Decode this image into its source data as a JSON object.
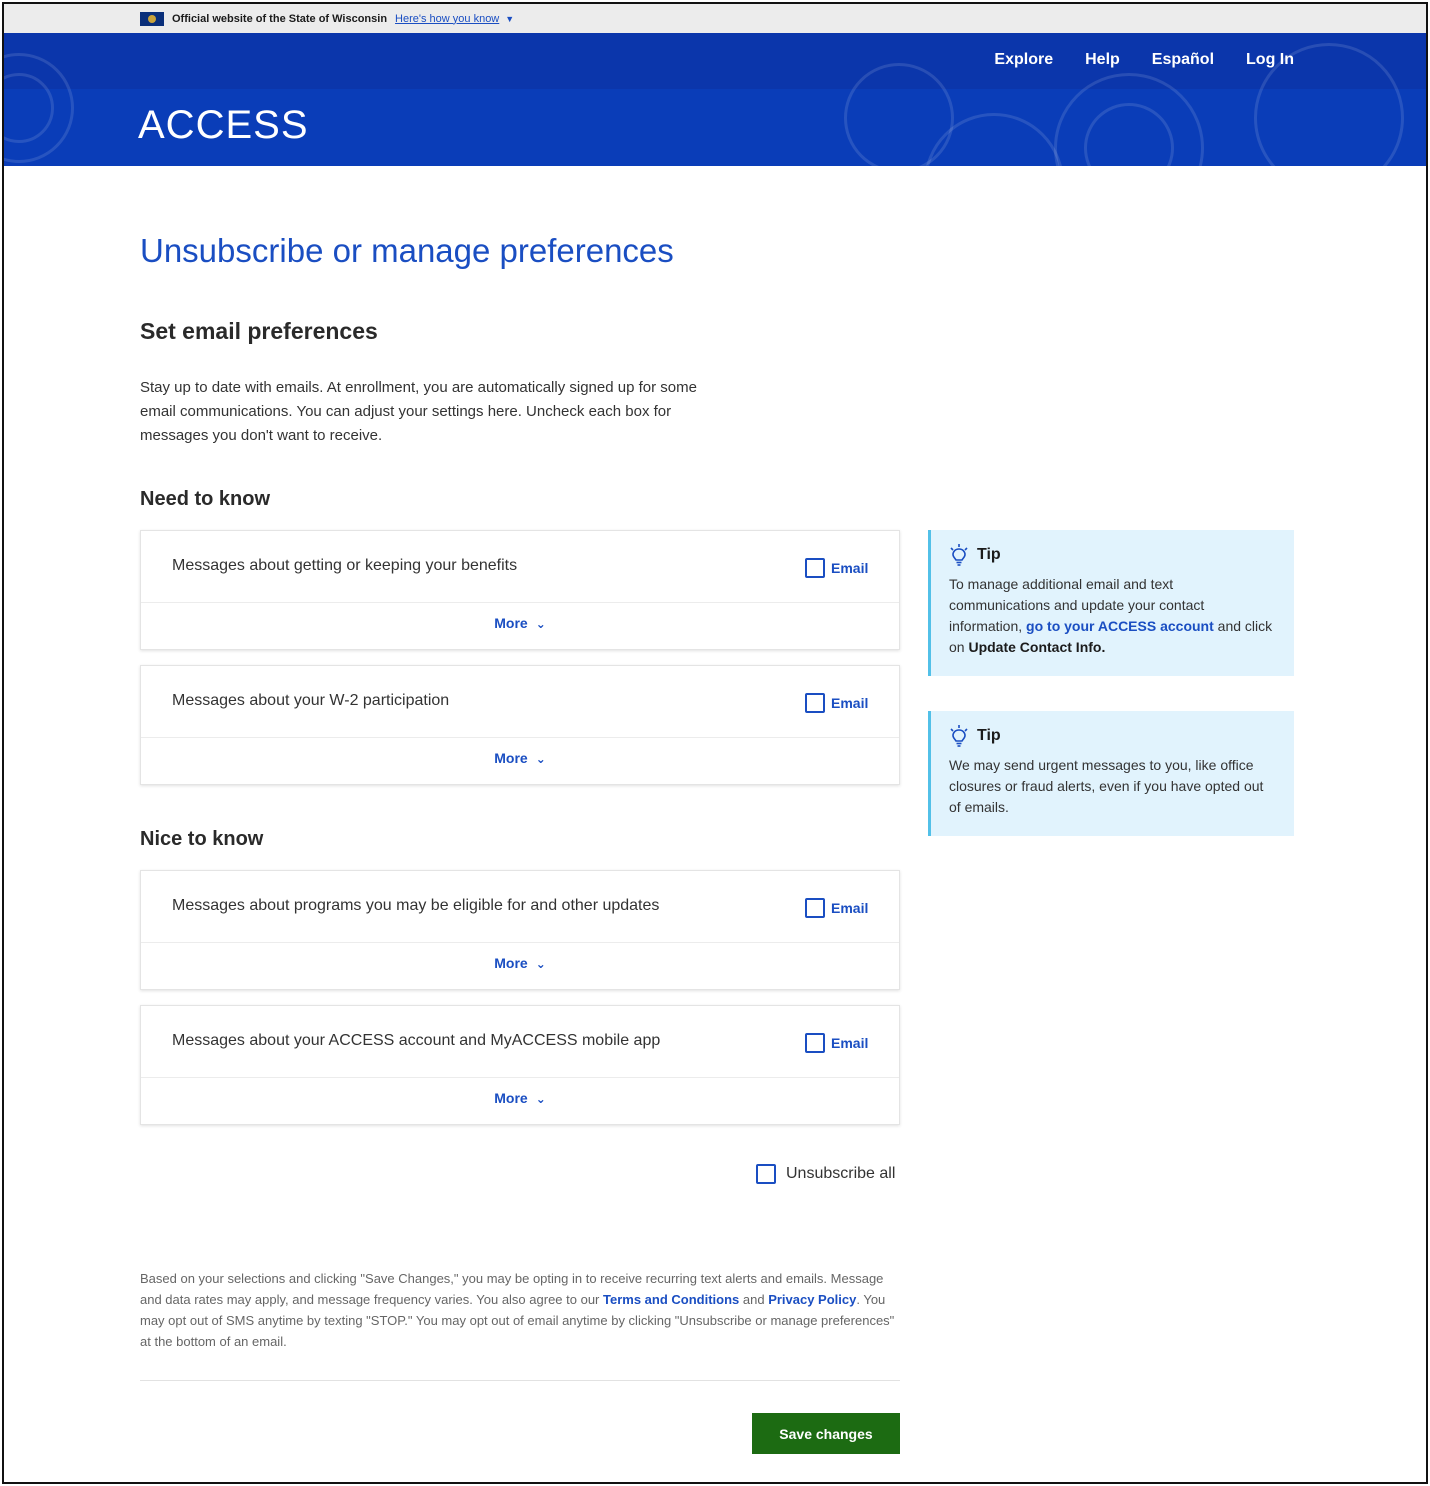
{
  "banner": {
    "official_text": "Official website of the State of Wisconsin",
    "how_know": "Here's how you know"
  },
  "nav": [
    "Explore",
    "Help",
    "Español",
    "Log In"
  ],
  "brand": "ACCESS",
  "page_title": "Unsubscribe or manage preferences",
  "section_title": "Set email preferences",
  "intro": "Stay up to date with emails. At enrollment, you are automatically signed up for some email communications. You can adjust your settings here. Uncheck each box for messages you don't want to receive.",
  "groups": [
    {
      "title": "Need to know",
      "items": [
        {
          "label": "Messages about getting or keeping your benefits",
          "check_label": "Email",
          "checked": false,
          "more": "More"
        },
        {
          "label": "Messages about your W-2 participation",
          "check_label": "Email",
          "checked": false,
          "more": "More"
        }
      ]
    },
    {
      "title": "Nice to know",
      "items": [
        {
          "label": "Messages about programs you may be eligible for and other updates",
          "check_label": "Email",
          "checked": false,
          "more": "More"
        },
        {
          "label": "Messages about your ACCESS account and MyACCESS mobile app",
          "check_label": "Email",
          "checked": false,
          "more": "More"
        }
      ]
    }
  ],
  "unsubscribe_all": {
    "label": "Unsubscribe all",
    "checked": false
  },
  "disclaimer": {
    "part1": "Based on your selections and clicking \"Save Changes,\" you may be opting in to receive recurring text alerts and emails. Message and data rates may apply, and message frequency varies. You also agree to our ",
    "terms": "Terms and Conditions",
    "part2": " and ",
    "privacy": "Privacy Policy",
    "part3": ". You may opt out of SMS anytime by texting \"STOP.\" You may opt out of email anytime by clicking \"Unsubscribe or manage preferences\" at the bottom of an email."
  },
  "save_button": "Save changes",
  "tips": [
    {
      "title": "Tip",
      "text1": "To manage additional email and text communications and update your contact information, ",
      "link": "go to your ACCESS account",
      "text2": " and click on ",
      "bold": "Update Contact Info."
    },
    {
      "title": "Tip",
      "text": "We may send urgent messages to you, like office closures or fraud alerts, even if you have opted out of emails."
    }
  ],
  "colors": {
    "primary_blue": "#0a3db8",
    "link_blue": "#1a4ec2",
    "save_green": "#1c6b12",
    "tip_bg": "#e1f3fd",
    "tip_border": "#52c0e8"
  },
  "icons": {
    "flag": "wisconsin-flag-icon",
    "chevron": "chevron-down-icon",
    "tip": "lightbulb-icon"
  }
}
